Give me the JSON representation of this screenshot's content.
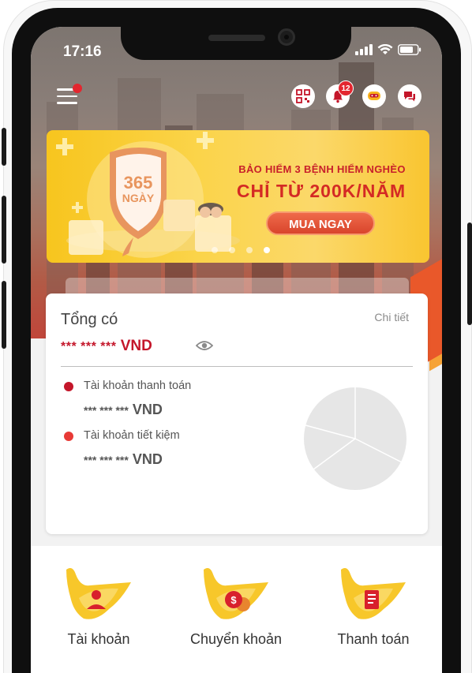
{
  "status_bar": {
    "time": "17:16"
  },
  "header": {
    "notification_count": "12",
    "icons": [
      "menu-icon",
      "qr-code-icon",
      "bell-icon",
      "chatbot-icon",
      "chat-icon"
    ]
  },
  "banner": {
    "badge_line1": "365",
    "badge_line2": "NGÀY",
    "line1": "BẢO HIỂM 3 BỆNH HIỂM NGHÈO",
    "line2": "CHỈ TỪ 200K/NĂM",
    "cta": "MUA NGAY",
    "slide_count": 4,
    "active_slide": 4
  },
  "balance_card": {
    "title": "Tổng có",
    "detail_link": "Chi tiết",
    "total_mask": "*** *** ***",
    "total_currency": "VND",
    "accounts": [
      {
        "label": "Tài khoản thanh toán",
        "mask": "*** *** ***",
        "currency": "VND",
        "color": "#c4162a"
      },
      {
        "label": "Tài khoản tiết kiệm",
        "mask": "*** *** ***",
        "currency": "VND",
        "color": "#e83a36"
      }
    ]
  },
  "features": [
    {
      "label": "Tài khoản",
      "icon": "user-icon"
    },
    {
      "label": "Chuyển khoản",
      "icon": "money-transfer-icon"
    },
    {
      "label": "Thanh toán",
      "icon": "bill-icon"
    }
  ],
  "colors": {
    "brand_red": "#c4162a",
    "accent_yellow": "#f9c530",
    "banner_text_red": "#d42a24"
  }
}
